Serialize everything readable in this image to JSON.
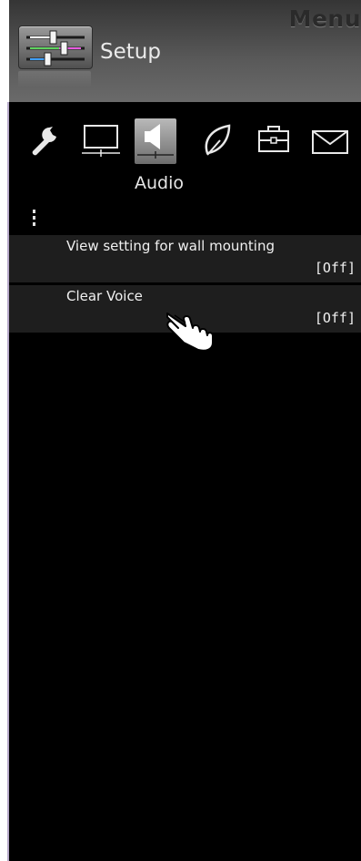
{
  "header": {
    "menu_title": "Menu",
    "section": "Setup",
    "setup_icon": "equalizer-sliders-icon"
  },
  "categories": {
    "icons": [
      "wrench-icon",
      "monitor-icon",
      "speaker-icon",
      "leaf-icon",
      "toolbox-icon",
      "envelope-icon"
    ],
    "selected_label": "Audio",
    "selected": "speaker-icon"
  },
  "settings": [
    {
      "label": "View setting for wall mounting",
      "value": "[Off]"
    },
    {
      "label": "Clear Voice",
      "value": "[Off]"
    }
  ],
  "cursor": {
    "icon": "hand-pointer-icon"
  },
  "colors": {
    "background": "#000000",
    "row_background": "#1e1e1e",
    "header_gradient_top": "#353535",
    "header_gradient_bottom": "#6a6a6a",
    "left_accent": "#b7a9c9"
  }
}
